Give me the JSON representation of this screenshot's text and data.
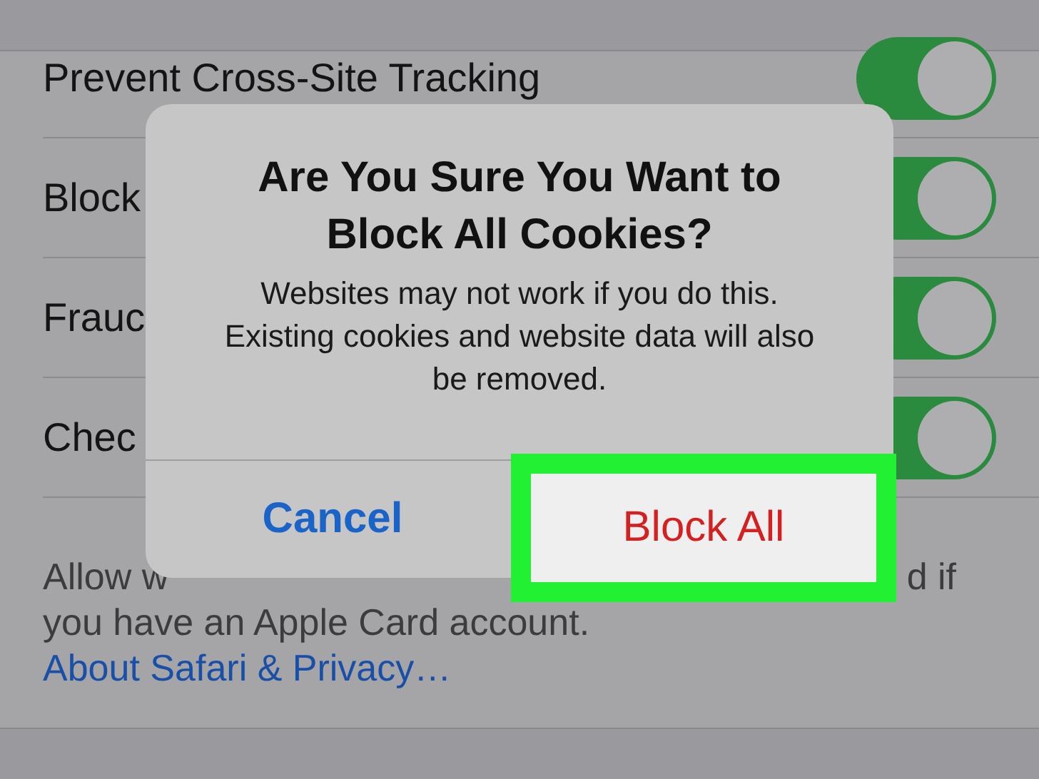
{
  "settings": [
    {
      "label": "Prevent Cross-Site Tracking",
      "on": true
    },
    {
      "label": "Block",
      "on": true
    },
    {
      "label": "Frauc",
      "on": true
    },
    {
      "label": "Chec",
      "on": true
    }
  ],
  "footer": {
    "line_1_start": "Allow w",
    "line_1_end": "d if",
    "line_2": "you have an Apple Card account.",
    "link": "About Safari & Privacy…"
  },
  "dialog": {
    "title": "Are You Sure You Want to Block All Cookies?",
    "message": "Websites may not work if you do this. Existing cookies and website data will also be removed.",
    "buttons": [
      {
        "label": "Cancel",
        "kind": "cancel",
        "highlighted": false
      },
      {
        "label": "Block All",
        "kind": "destructive",
        "highlighted": true
      }
    ]
  }
}
